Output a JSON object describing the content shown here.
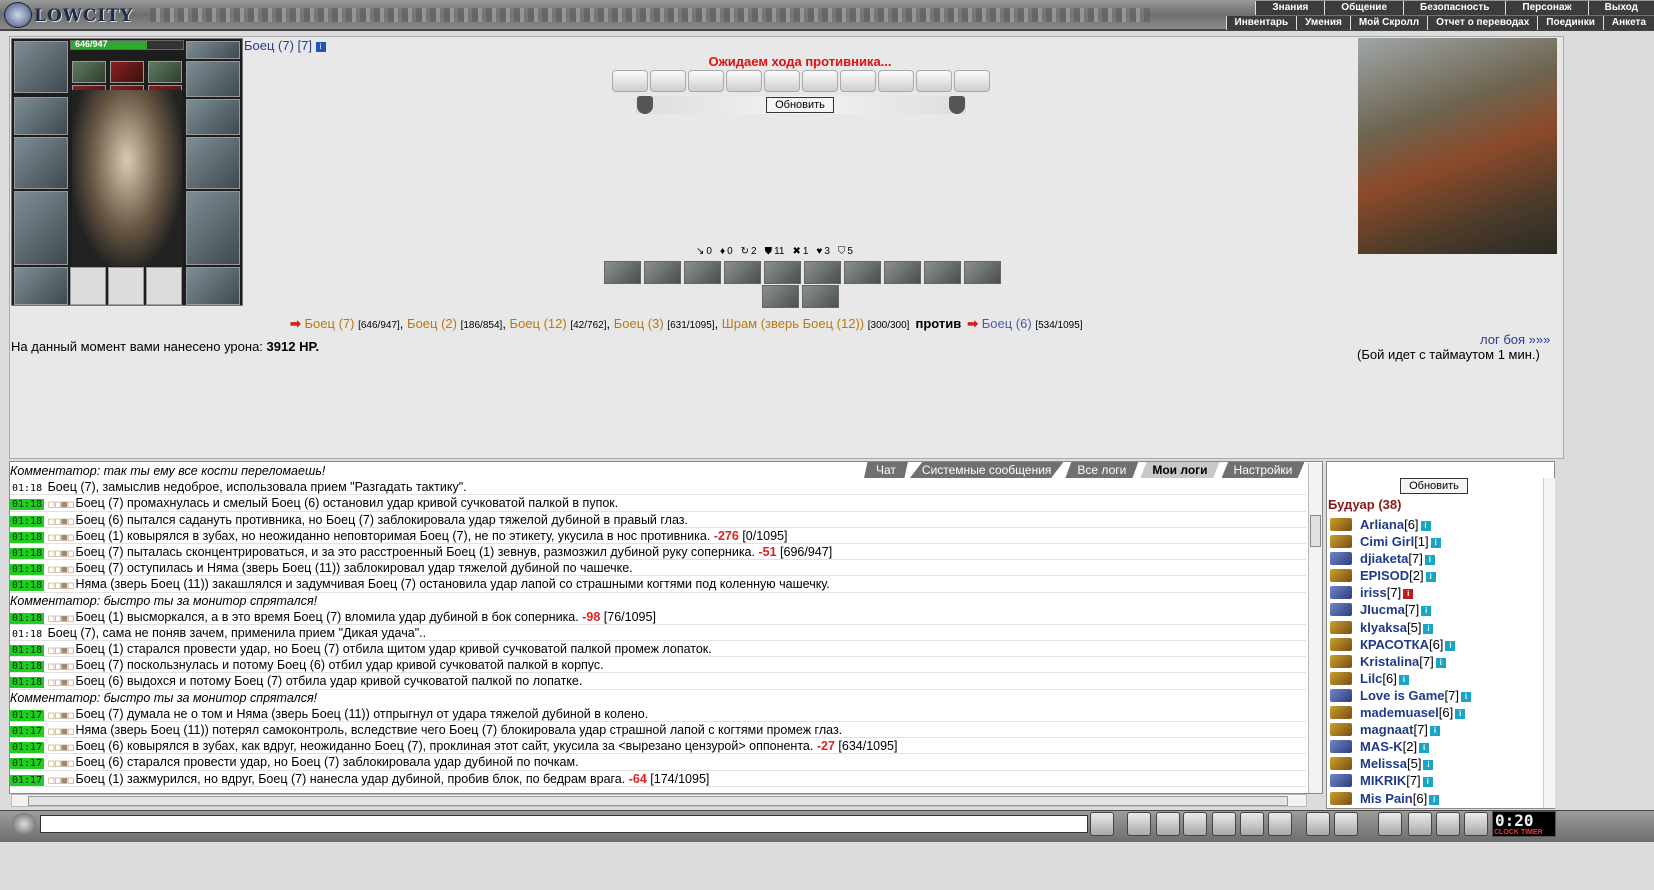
{
  "app": {
    "logo_text": "LOWCITY"
  },
  "menu_top": [
    "Знания",
    "Общение",
    "Безопасность",
    "Персонаж",
    "Выход"
  ],
  "menu_bottom": [
    "Инвентарь",
    "Умения",
    "Мой Скролл",
    "Отчет о переводах",
    "Поединки",
    "Анкета"
  ],
  "player": {
    "name": "Боец (7) [7]",
    "info_icon": "info-icon",
    "hp_text": "646/947",
    "hp_fraction": 0.68
  },
  "battle": {
    "waiting": "Ожидаем хода противника...",
    "refresh_label": "Обновить",
    "stats": [
      "0",
      "0",
      "2",
      "11",
      "1",
      "3",
      "5"
    ],
    "team1": [
      {
        "name": "Боец (7)",
        "hp": "[646/947]"
      },
      {
        "name": "Боец (2)",
        "hp": "[186/854]"
      },
      {
        "name": "Боец (12)",
        "hp": "[42/762]"
      },
      {
        "name": "Боец (3)",
        "hp": "[631/1095]"
      },
      {
        "name": "Шрам (зверь Боец (12))",
        "hp": "[300/300]"
      }
    ],
    "vs": "против",
    "team2": [
      {
        "name": "Боец (6)",
        "hp": "[534/1095]"
      }
    ],
    "log_link": "лог боя »»»",
    "timeout_text": "(Бой идет с таймаутом 1 мин.)",
    "damage_label": "На данный момент вами нанесено урона:",
    "damage_value": "3912 HP."
  },
  "chat": {
    "tabs": [
      "Чат",
      "Системные сообщения",
      "Все логи",
      "Мои логи",
      "Настройки"
    ],
    "active_tab": "Мои логи",
    "lines": [
      {
        "type": "com",
        "text": "Комментатор: так ты ему все кости переломаешь!"
      },
      {
        "type": "plain",
        "time": "01:18",
        "text": "Боец (7), замыслив недоброе, использовала прием \"Разгадать тактику\"."
      },
      {
        "type": "log",
        "time": "01:18",
        "text": "Боец (7) промахнулась и смелый Боец (6) остановил удар кривой сучковатой палкой в пупок."
      },
      {
        "type": "log",
        "time": "01:18",
        "text": "Боец (6) пытался садануть противника, но Боец (7) заблокировала удар тяжелой дубиной в правый глаз."
      },
      {
        "type": "log",
        "time": "01:18",
        "text": "Боец (1) ковырялся в зубах, но неожиданно неповторимая Боец (7), не по этикету, укусила в нос противника.",
        "dmg": "-276",
        "hp": "[0/1095]"
      },
      {
        "type": "log",
        "time": "01:18",
        "text": "Боец (7) пыталась сконцентрироваться, и за это расстроенный Боец (1) зевнув, размозжил дубиной руку соперника.",
        "dmg": "-51",
        "hp": "[696/947]"
      },
      {
        "type": "log",
        "time": "01:18",
        "text": "Боец (7) оступилась и Няма (зверь Боец (11)) заблокировал удар тяжелой дубиной по чашечке."
      },
      {
        "type": "log",
        "time": "01:18",
        "text": "Няма (зверь Боец (11)) закашлялся и задумчивая Боец (7) остановила удар лапой со страшными когтями под коленную чашечку."
      },
      {
        "type": "com",
        "text": "Комментатор: быстро ты за монитор спрятался!"
      },
      {
        "type": "log",
        "time": "01:18",
        "text": "Боец (1) высморкался, а в это время Боец (7) вломила удар дубиной в бок соперника.",
        "dmg": "-98",
        "hp": "[76/1095]"
      },
      {
        "type": "plain",
        "time": "01:18",
        "text": "Боец (7), сама не поняв зачем, применила прием \"Дикая удача\".."
      },
      {
        "type": "log",
        "time": "01:18",
        "text": "Боец (1) старался провести удар, но Боец (7) отбила щитом удар кривой сучковатой палкой промеж лопаток."
      },
      {
        "type": "log",
        "time": "01:18",
        "text": "Боец (7) поскользнулась и потому Боец (6) отбил удар кривой сучковатой палкой в корпус."
      },
      {
        "type": "log",
        "time": "01:18",
        "text": "Боец (6) выдохся и потому Боец (7) отбила удар кривой сучковатой палкой по лопатке."
      },
      {
        "type": "com",
        "text": "Комментатор: быстро ты за монитор спрятался!"
      },
      {
        "type": "log",
        "time": "01:17",
        "text": "Боец (7) думала не о том и Няма (зверь Боец (11)) отпрыгнул от удара тяжелой дубиной в колено."
      },
      {
        "type": "log",
        "time": "01:17",
        "text": "Няма (зверь Боец (11)) потерял самоконтроль, вследствие чего Боец (7) блокировала удар страшной лапой с когтями промеж глаз."
      },
      {
        "type": "log",
        "time": "01:17",
        "text": "Боец (6) ковырялся в зубах, как вдруг, неожиданно Боец (7), проклиная этот сайт, укусила за <вырезано цензурой> оппонента.",
        "dmg": "-27",
        "hp": "[634/1095]"
      },
      {
        "type": "log",
        "time": "01:17",
        "text": "Боец (6) старался провести удар, но Боец (7) заблокировала удар дубиной по почкам."
      },
      {
        "type": "log",
        "time": "01:17",
        "text": "Боец (1) зажмурился, но вдруг, Боец (7) нанесла удар дубиной, пробив блок, по бедрам врага.",
        "dmg": "-64",
        "hp": "[174/1095]"
      }
    ]
  },
  "room": {
    "refresh_label": "Обновить",
    "title": "Будуар (38)",
    "users": [
      {
        "name": "Arliana",
        "lvl": "[6]",
        "icon": "a"
      },
      {
        "name": "Cimi Girl",
        "lvl": "[1]",
        "icon": "a"
      },
      {
        "name": "djiaketa",
        "lvl": "[7]",
        "icon": "b"
      },
      {
        "name": "EPISOD",
        "lvl": "[2]",
        "icon": "a"
      },
      {
        "name": "iriss",
        "lvl": "[7]",
        "icon": "b",
        "red": true
      },
      {
        "name": "JIucma",
        "lvl": "[7]",
        "icon": "b"
      },
      {
        "name": "klyaksa",
        "lvl": "[5]",
        "icon": "a"
      },
      {
        "name": "КРАСОТКА",
        "lvl": "[6]",
        "icon": "a"
      },
      {
        "name": "Kristalina",
        "lvl": "[7]",
        "icon": "a"
      },
      {
        "name": "Lilc",
        "lvl": "[6]",
        "icon": "a"
      },
      {
        "name": "Love is Game",
        "lvl": "[7]",
        "icon": "b"
      },
      {
        "name": "mademuasel",
        "lvl": "[6]",
        "icon": "a"
      },
      {
        "name": "magnaat",
        "lvl": "[7]",
        "icon": "a"
      },
      {
        "name": "MAS-K",
        "lvl": "[2]",
        "icon": "b"
      },
      {
        "name": "Melissa",
        "lvl": "[5]",
        "icon": "a"
      },
      {
        "name": "MIKRIK",
        "lvl": "[7]",
        "icon": "b"
      },
      {
        "name": "Mis Pain",
        "lvl": "[6]",
        "icon": "a"
      }
    ]
  },
  "clock": {
    "time": "0:20",
    "sec": "42",
    "labels": "CLOCK TIMER"
  }
}
